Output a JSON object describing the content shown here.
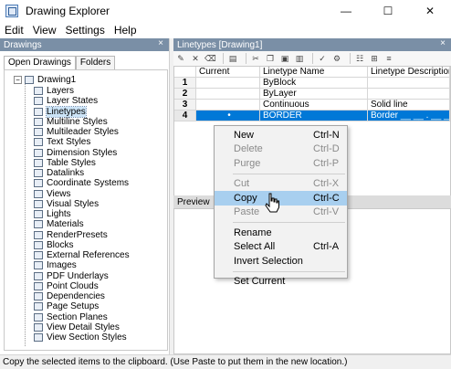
{
  "window": {
    "title": "Drawing Explorer",
    "minimize": "—",
    "maximize": "☐",
    "close": "✕"
  },
  "menu": [
    {
      "label": "Edit"
    },
    {
      "label": "View"
    },
    {
      "label": "Settings"
    },
    {
      "label": "Help"
    }
  ],
  "left": {
    "header": "Drawings",
    "close": "×",
    "tabs": [
      {
        "label": "Open Drawings"
      },
      {
        "label": "Folders"
      }
    ],
    "root": "Drawing1",
    "items": [
      {
        "label": "Layers",
        "icon": "layers-icon"
      },
      {
        "label": "Layer States",
        "icon": "layer-states-icon"
      },
      {
        "label": "Linetypes",
        "icon": "linetypes-icon"
      },
      {
        "label": "Multiline Styles",
        "icon": "multiline-icon"
      },
      {
        "label": "Multileader Styles",
        "icon": "multileader-icon"
      },
      {
        "label": "Text Styles",
        "icon": "text-style-icon"
      },
      {
        "label": "Dimension Styles",
        "icon": "dimension-icon"
      },
      {
        "label": "Table Styles",
        "icon": "table-icon"
      },
      {
        "label": "Datalinks",
        "icon": "datalink-icon"
      },
      {
        "label": "Coordinate Systems",
        "icon": "coordinate-icon"
      },
      {
        "label": "Views",
        "icon": "views-icon"
      },
      {
        "label": "Visual Styles",
        "icon": "visual-style-icon"
      },
      {
        "label": "Lights",
        "icon": "light-icon"
      },
      {
        "label": "Materials",
        "icon": "material-icon"
      },
      {
        "label": "RenderPresets",
        "icon": "render-icon"
      },
      {
        "label": "Blocks",
        "icon": "block-icon"
      },
      {
        "label": "External References",
        "icon": "xref-icon"
      },
      {
        "label": "Images",
        "icon": "image-icon"
      },
      {
        "label": "PDF Underlays",
        "icon": "pdf-icon"
      },
      {
        "label": "Point Clouds",
        "icon": "point-cloud-icon"
      },
      {
        "label": "Dependencies",
        "icon": "dependency-icon"
      },
      {
        "label": "Page Setups",
        "icon": "page-setup-icon"
      },
      {
        "label": "Section Planes",
        "icon": "section-plane-icon"
      },
      {
        "label": "View Detail Styles",
        "icon": "detail-style-icon"
      },
      {
        "label": "View Section Styles",
        "icon": "section-style-icon"
      }
    ]
  },
  "right": {
    "header": "Linetypes [Drawing1]",
    "close": "×",
    "columns": [
      "",
      "Current",
      "Linetype Name",
      "Linetype Description"
    ],
    "rows": [
      {
        "num": "1",
        "current": "",
        "name": "ByBlock",
        "desc": ""
      },
      {
        "num": "2",
        "current": "",
        "name": "ByLayer",
        "desc": ""
      },
      {
        "num": "3",
        "current": "",
        "name": "Continuous",
        "desc": "Solid line"
      },
      {
        "num": "4",
        "current": "•",
        "name": "BORDER",
        "desc": "Border __ __ . __ __ . __"
      }
    ],
    "preview": "Preview",
    "scroll_left": "‹",
    "scroll_right": "›"
  },
  "context_menu": [
    {
      "label": "New",
      "key": "Ctrl-N",
      "enabled": true
    },
    {
      "label": "Delete",
      "key": "Ctrl-D",
      "enabled": false
    },
    {
      "label": "Purge",
      "key": "Ctrl-P",
      "enabled": false
    },
    {
      "sep": true
    },
    {
      "label": "Cut",
      "key": "Ctrl-X",
      "enabled": false
    },
    {
      "label": "Copy",
      "key": "Ctrl-C",
      "enabled": true,
      "hover": true
    },
    {
      "label": "Paste",
      "key": "Ctrl-V",
      "enabled": false
    },
    {
      "sep": true
    },
    {
      "label": "Rename",
      "key": "",
      "enabled": true
    },
    {
      "label": "Select All",
      "key": "Ctrl-A",
      "enabled": true
    },
    {
      "label": "Invert Selection",
      "key": "",
      "enabled": true
    },
    {
      "sep": true
    },
    {
      "label": "Set Current",
      "key": "",
      "enabled": true
    }
  ],
  "status": "Copy the selected items to the clipboard. (Use Paste to put them in the new location.)"
}
